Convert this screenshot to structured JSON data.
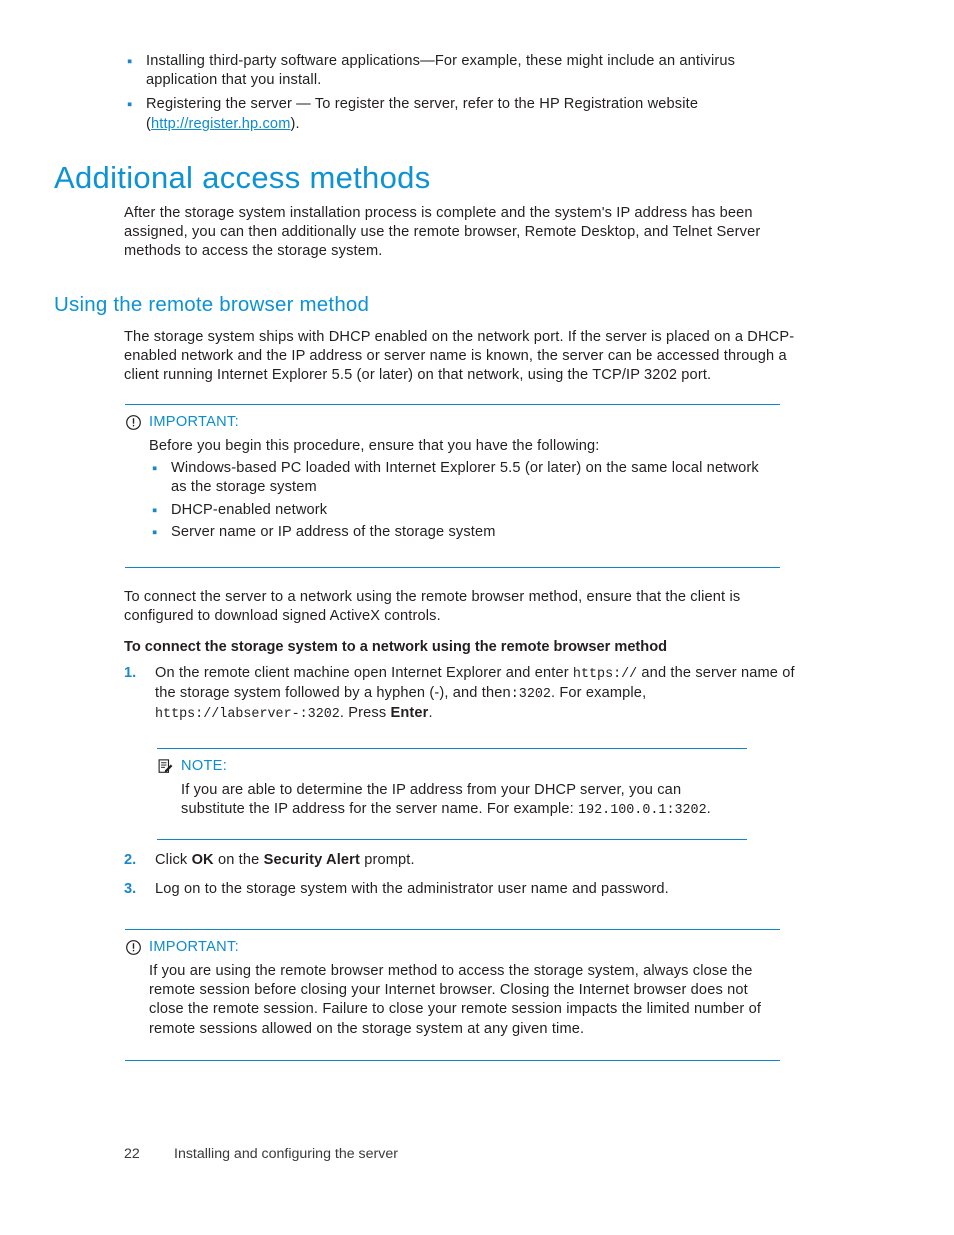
{
  "colors": {
    "heading": "#0d92d4",
    "link": "#0d8bd1",
    "rule": "#0e87c6",
    "step_number": "#1b87c9",
    "bullet": "#1b87c9",
    "body_text": "#231f20"
  },
  "top_list": {
    "items": [
      {
        "text_before": "Installing third-party software applications—For example, these might include an antivirus application that you install.",
        "has_link": false
      },
      {
        "text_before": "Registering the server — To register the server, refer to the HP Registration website (",
        "link_text": "http://register.hp.com",
        "text_after": ").",
        "has_link": true
      }
    ]
  },
  "section": {
    "title": "Additional access methods",
    "intro": "After the storage system installation process is complete and the system's IP address has been assigned, you can then additionally use the remote browser, Remote Desktop, and Telnet Server methods to access the storage system."
  },
  "subsection": {
    "title": "Using the remote browser method",
    "intro": "The storage system ships with DHCP enabled on the network port. If the server is placed on a DHCP-enabled network and the IP address or server name is known, the server can be accessed through a client running Internet Explorer 5.5 (or later) on that network, using the TCP/IP 3202 port."
  },
  "important_1": {
    "icon": "circle-exclamation-icon",
    "label": "IMPORTANT:",
    "intro": "Before you begin this procedure, ensure that you have the following:",
    "items": [
      "Windows-based PC loaded with Internet Explorer 5.5 (or later) on the same local network as the storage system",
      "DHCP-enabled network",
      "Server name or IP address of the storage system"
    ]
  },
  "connect_para": "To connect the server to a network using the remote browser method, ensure that the client is configured to download signed ActiveX controls.",
  "procedure": {
    "title": "To connect the storage system to a network using the remote browser method",
    "steps": [
      {
        "number": "1.",
        "seg_1": "On the remote client machine open Internet Explorer and enter ",
        "code_1": "https://",
        "seg_2": " and the server name of the storage system followed by a hyphen (-), and then",
        "code_2": ":3202",
        "seg_3": ". For example, ",
        "code_3": "https://labserver-:3202",
        "seg_4": ". Press ",
        "bold_1": "Enter",
        "seg_5": "."
      },
      {
        "number": "2.",
        "seg_1": "Click ",
        "bold_1": "OK",
        "seg_2": " on the ",
        "bold_2": "Security Alert",
        "seg_3": " prompt."
      },
      {
        "number": "3.",
        "seg_1": "Log on to the storage system with the administrator user name and password."
      }
    ]
  },
  "note_1": {
    "icon": "notepad-pencil-icon",
    "label": "NOTE:",
    "seg_1": "If you are able to determine the IP address from your DHCP server, you can substitute the IP address for the server name. For example: ",
    "code_1": "192.100.0.1:3202",
    "seg_2": "."
  },
  "important_2": {
    "icon": "circle-exclamation-icon",
    "label": "IMPORTANT:",
    "text": "If you are using the remote browser method to access the storage system, always close the remote session before closing your Internet browser. Closing the Internet browser does not close the remote session. Failure to close your remote session impacts the limited number of remote sessions allowed on the storage system at any given time."
  },
  "footer": {
    "page_number": "22",
    "chapter": "Installing and configuring the server"
  }
}
